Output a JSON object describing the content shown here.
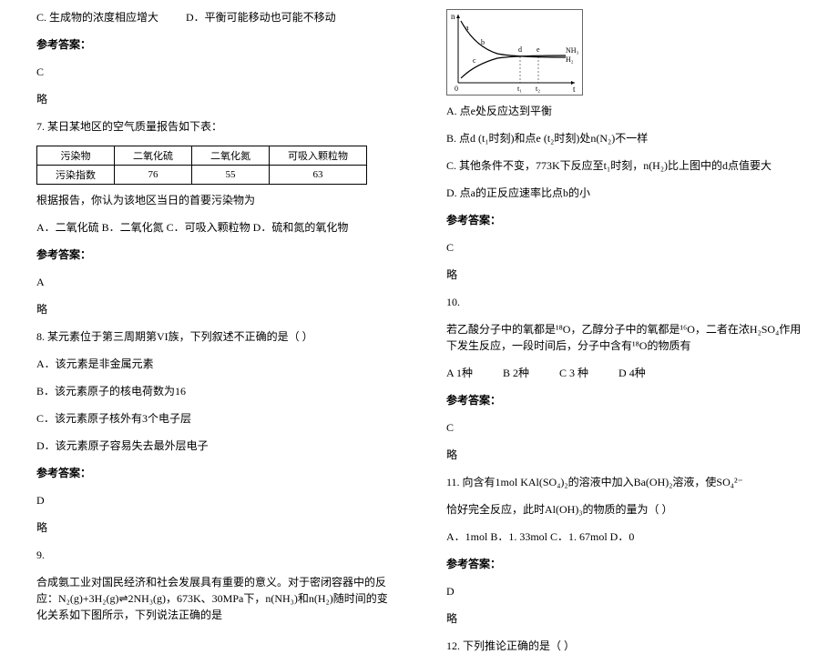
{
  "left": {
    "q6_optC": "C. 生成物的浓度相应增大",
    "q6_optD": "D．平衡可能移动也可能不移动",
    "ref_label": "参考答案：",
    "q6_ans": "C",
    "skip": "略",
    "q7_stem": "7. 某日某地区的空气质量报告如下表：",
    "q7_table": {
      "h1": "污染物",
      "h2": "二氧化硫",
      "h3": "二氧化氮",
      "h4": "可吸入颗粒物",
      "r1": "污染指数",
      "r2": "76",
      "r3": "55",
      "r4": "63"
    },
    "q7_stem2": "根据报告，你认为该地区当日的首要污染物为",
    "q7_opts": "A．二氧化硫  B．二氧化氮 C．可吸入颗粒物 D．硫和氮的氧化物",
    "q7_ans": "A",
    "q8_stem": "8. 某元素位于第三周期第VI族，下列叙述不正确的是（   ）",
    "q8_A": "A．该元素是非金属元素",
    "q8_B": "B．该元素原子的核电荷数为16",
    "q8_C": "C．该元素原子核外有3个电子层",
    "q8_D": "D．该元素原子容易失去最外层电子",
    "q8_ans": "D",
    "q9_num": "9.",
    "q9_stem": "合成氨工业对国民经济和社会发展具有重要的意义。对于密闭容器中的反应：N₂(g)+3H₂(g)⇌2NH₃(g)，673K、30MPa下，n(NH₃)和n(H₂)随时间的变化关系如下图所示，下列说法正确的是"
  },
  "right": {
    "chart_labels": {
      "y": "n",
      "x": "t",
      "nh3": "NH₃",
      "h2": "H₂",
      "a": "a",
      "b": "b",
      "c": "c",
      "d": "d",
      "e": "e",
      "t1": "t₁",
      "t2": "t₂"
    },
    "q9_A": "A. 点e处反应达到平衡",
    "q9_B": "B. 点d (t₁时刻)和点e (t₂时刻)处n(N₂)不一样",
    "q9_C": "C. 其他条件不变，773K下反应至t₁时刻，n(H₂)比上图中的d点值要大",
    "q9_D": "D. 点a的正反应速率比点b的小",
    "ref_label": "参考答案：",
    "q9_ans": "C",
    "skip": "略",
    "q10_num": "10.",
    "q10_stem": "若乙酸分子中的氧都是¹⁸O，乙醇分子中的氧都是¹⁶O，二者在浓H₂SO₄作用下发生反应，一段时间后，分子中含有¹⁸O的物质有",
    "q10_A": "A   1种",
    "q10_B": "B   2种",
    "q10_C": "C   3 种",
    "q10_D": "D   4种",
    "q10_ans": "C",
    "q11_stem1": "11. 向含有1mol KAl(SO₄)₂的溶液中加入Ba(OH)₂溶液，使SO₄²⁻",
    "q11_stem2": "恰好完全反应，此时Al(OH)₃的物质的量为（   ）",
    "q11_opts": "A．1mol     B．1. 33mol     C．1. 67mol     D．0",
    "q11_ans": "D",
    "q12_stem": "12. 下列推论正确的是（     ）"
  }
}
